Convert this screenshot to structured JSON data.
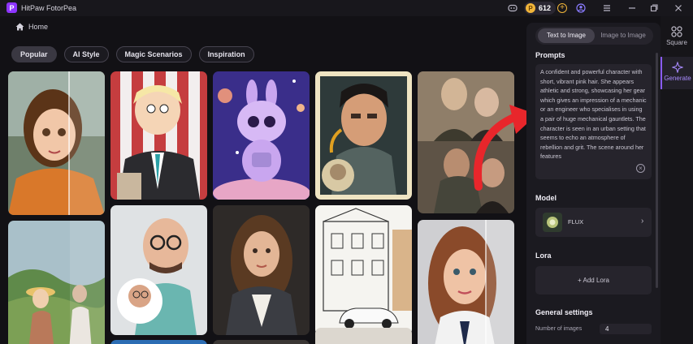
{
  "titlebar": {
    "app_title": "HitPaw FotorPea",
    "credits": "612",
    "logo_letter": "P"
  },
  "nav": {
    "home_label": "Home"
  },
  "tabs": [
    {
      "label": "Popular",
      "active": true
    },
    {
      "label": "AI Style",
      "active": false
    },
    {
      "label": "Magic Scenarios",
      "active": false
    },
    {
      "label": "Inspiration",
      "active": false
    }
  ],
  "panel": {
    "mode_tabs": [
      {
        "label": "Text to Image",
        "active": true
      },
      {
        "label": "Image to Image",
        "active": false
      }
    ],
    "prompts_title": "Prompts",
    "prompt_text": "A confident and powerful character with short, vibrant pink hair. She appears athletic and strong, showcasing her gear which gives an impression of a mechanic or an engineer who specialises in using a pair of huge mechanical gauntlets. The character is seen in an urban setting that seems to echo an atmosphere of rebellion and grit. The scene around her features",
    "model_title": "Model",
    "model_name": "FLUX",
    "lora_title": "Lora",
    "add_lora_label": "+ Add Lora",
    "general_title": "General settings",
    "num_images_label": "Number of images",
    "num_images_value": "4"
  },
  "rail": {
    "square_label": "Square",
    "generate_label": "Generate"
  },
  "colors": {
    "accent": "#8a5cff",
    "background": "#121115",
    "panel": "#1b1a20",
    "arrow": "#e8262b"
  },
  "icons": [
    "app-logo-icon",
    "discord-icon",
    "coin-icon",
    "plus-icon",
    "user-icon",
    "menu-icon",
    "minimize-icon",
    "maximize-icon",
    "close-icon",
    "home-icon",
    "clear-icon",
    "chevron-right-icon",
    "square-icon",
    "generate-icon"
  ]
}
